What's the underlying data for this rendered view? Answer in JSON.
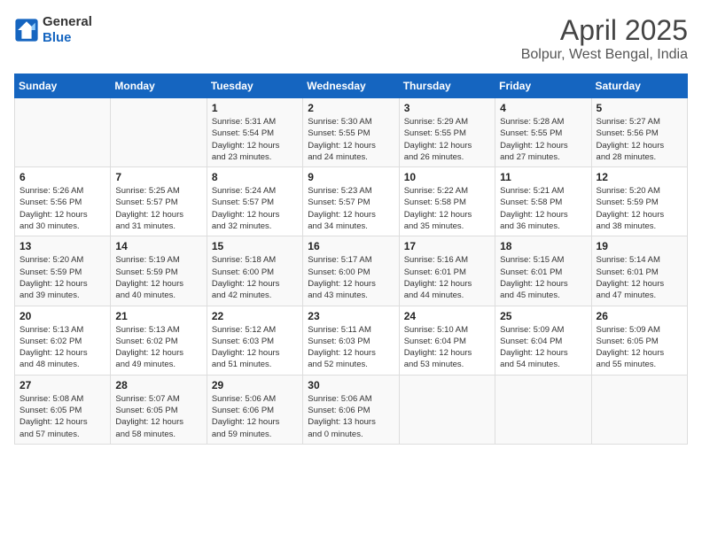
{
  "header": {
    "logo_general": "General",
    "logo_blue": "Blue",
    "month": "April 2025",
    "location": "Bolpur, West Bengal, India"
  },
  "weekdays": [
    "Sunday",
    "Monday",
    "Tuesday",
    "Wednesday",
    "Thursday",
    "Friday",
    "Saturday"
  ],
  "weeks": [
    [
      {
        "day": "",
        "info": ""
      },
      {
        "day": "",
        "info": ""
      },
      {
        "day": "1",
        "info": "Sunrise: 5:31 AM\nSunset: 5:54 PM\nDaylight: 12 hours\nand 23 minutes."
      },
      {
        "day": "2",
        "info": "Sunrise: 5:30 AM\nSunset: 5:55 PM\nDaylight: 12 hours\nand 24 minutes."
      },
      {
        "day": "3",
        "info": "Sunrise: 5:29 AM\nSunset: 5:55 PM\nDaylight: 12 hours\nand 26 minutes."
      },
      {
        "day": "4",
        "info": "Sunrise: 5:28 AM\nSunset: 5:55 PM\nDaylight: 12 hours\nand 27 minutes."
      },
      {
        "day": "5",
        "info": "Sunrise: 5:27 AM\nSunset: 5:56 PM\nDaylight: 12 hours\nand 28 minutes."
      }
    ],
    [
      {
        "day": "6",
        "info": "Sunrise: 5:26 AM\nSunset: 5:56 PM\nDaylight: 12 hours\nand 30 minutes."
      },
      {
        "day": "7",
        "info": "Sunrise: 5:25 AM\nSunset: 5:57 PM\nDaylight: 12 hours\nand 31 minutes."
      },
      {
        "day": "8",
        "info": "Sunrise: 5:24 AM\nSunset: 5:57 PM\nDaylight: 12 hours\nand 32 minutes."
      },
      {
        "day": "9",
        "info": "Sunrise: 5:23 AM\nSunset: 5:57 PM\nDaylight: 12 hours\nand 34 minutes."
      },
      {
        "day": "10",
        "info": "Sunrise: 5:22 AM\nSunset: 5:58 PM\nDaylight: 12 hours\nand 35 minutes."
      },
      {
        "day": "11",
        "info": "Sunrise: 5:21 AM\nSunset: 5:58 PM\nDaylight: 12 hours\nand 36 minutes."
      },
      {
        "day": "12",
        "info": "Sunrise: 5:20 AM\nSunset: 5:59 PM\nDaylight: 12 hours\nand 38 minutes."
      }
    ],
    [
      {
        "day": "13",
        "info": "Sunrise: 5:20 AM\nSunset: 5:59 PM\nDaylight: 12 hours\nand 39 minutes."
      },
      {
        "day": "14",
        "info": "Sunrise: 5:19 AM\nSunset: 5:59 PM\nDaylight: 12 hours\nand 40 minutes."
      },
      {
        "day": "15",
        "info": "Sunrise: 5:18 AM\nSunset: 6:00 PM\nDaylight: 12 hours\nand 42 minutes."
      },
      {
        "day": "16",
        "info": "Sunrise: 5:17 AM\nSunset: 6:00 PM\nDaylight: 12 hours\nand 43 minutes."
      },
      {
        "day": "17",
        "info": "Sunrise: 5:16 AM\nSunset: 6:01 PM\nDaylight: 12 hours\nand 44 minutes."
      },
      {
        "day": "18",
        "info": "Sunrise: 5:15 AM\nSunset: 6:01 PM\nDaylight: 12 hours\nand 45 minutes."
      },
      {
        "day": "19",
        "info": "Sunrise: 5:14 AM\nSunset: 6:01 PM\nDaylight: 12 hours\nand 47 minutes."
      }
    ],
    [
      {
        "day": "20",
        "info": "Sunrise: 5:13 AM\nSunset: 6:02 PM\nDaylight: 12 hours\nand 48 minutes."
      },
      {
        "day": "21",
        "info": "Sunrise: 5:13 AM\nSunset: 6:02 PM\nDaylight: 12 hours\nand 49 minutes."
      },
      {
        "day": "22",
        "info": "Sunrise: 5:12 AM\nSunset: 6:03 PM\nDaylight: 12 hours\nand 51 minutes."
      },
      {
        "day": "23",
        "info": "Sunrise: 5:11 AM\nSunset: 6:03 PM\nDaylight: 12 hours\nand 52 minutes."
      },
      {
        "day": "24",
        "info": "Sunrise: 5:10 AM\nSunset: 6:04 PM\nDaylight: 12 hours\nand 53 minutes."
      },
      {
        "day": "25",
        "info": "Sunrise: 5:09 AM\nSunset: 6:04 PM\nDaylight: 12 hours\nand 54 minutes."
      },
      {
        "day": "26",
        "info": "Sunrise: 5:09 AM\nSunset: 6:05 PM\nDaylight: 12 hours\nand 55 minutes."
      }
    ],
    [
      {
        "day": "27",
        "info": "Sunrise: 5:08 AM\nSunset: 6:05 PM\nDaylight: 12 hours\nand 57 minutes."
      },
      {
        "day": "28",
        "info": "Sunrise: 5:07 AM\nSunset: 6:05 PM\nDaylight: 12 hours\nand 58 minutes."
      },
      {
        "day": "29",
        "info": "Sunrise: 5:06 AM\nSunset: 6:06 PM\nDaylight: 12 hours\nand 59 minutes."
      },
      {
        "day": "30",
        "info": "Sunrise: 5:06 AM\nSunset: 6:06 PM\nDaylight: 13 hours\nand 0 minutes."
      },
      {
        "day": "",
        "info": ""
      },
      {
        "day": "",
        "info": ""
      },
      {
        "day": "",
        "info": ""
      }
    ]
  ]
}
